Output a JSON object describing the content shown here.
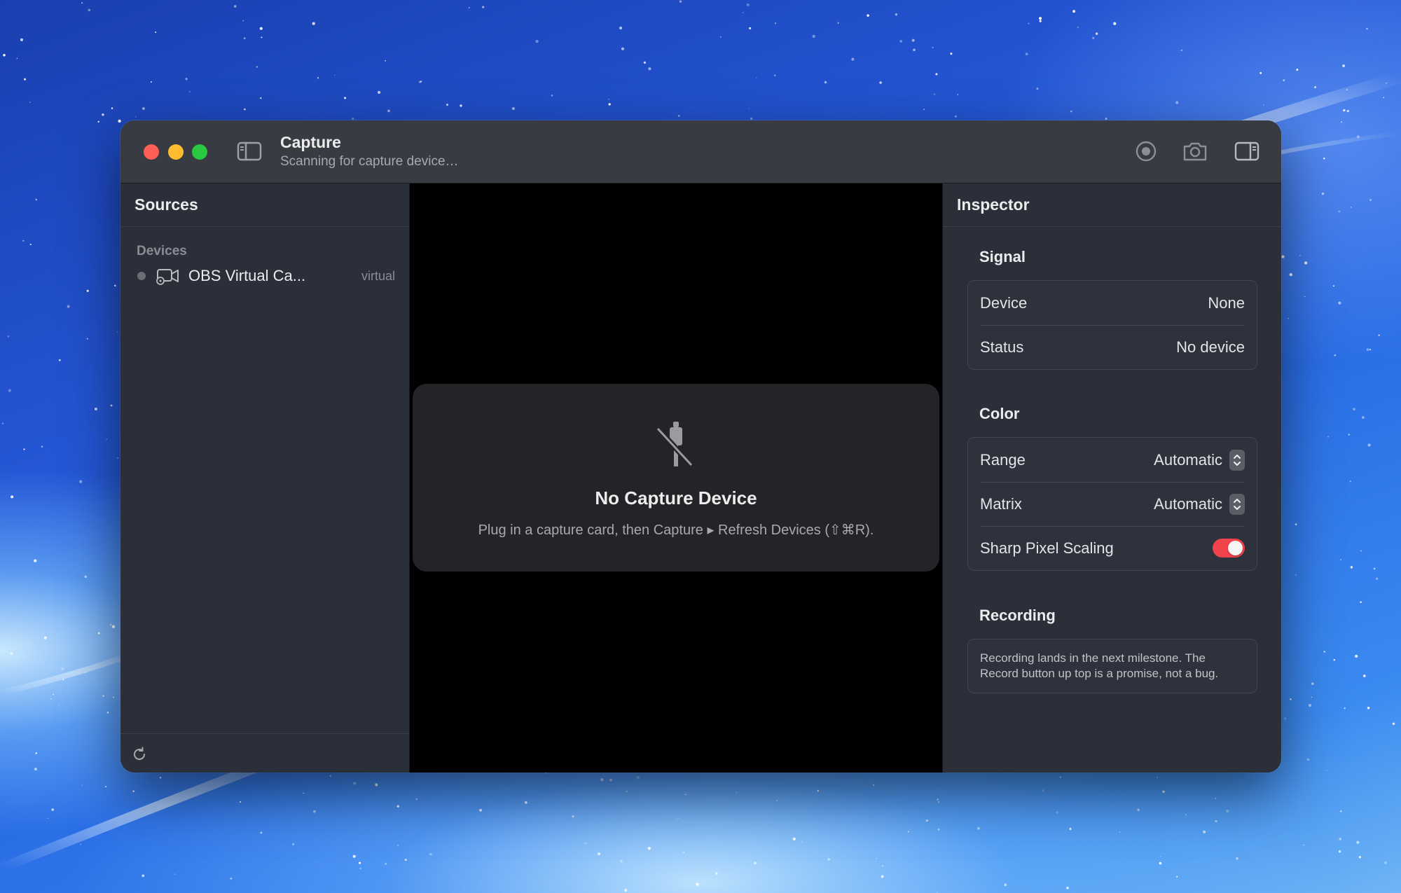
{
  "window": {
    "title": "Capture",
    "subtitle": "Scanning for capture device…"
  },
  "toolbar": {
    "sidebar_toggle_icon": "sidebar-left-icon",
    "record_icon": "record-icon",
    "snapshot_icon": "camera-icon",
    "inspector_toggle_icon": "sidebar-right-icon"
  },
  "sidebar": {
    "header": "Sources",
    "section_label": "Devices",
    "devices": [
      {
        "name": "OBS Virtual Ca...",
        "tag": "virtual",
        "icon": "video-camera-icon"
      }
    ],
    "footer_icon": "refresh-icon"
  },
  "preview": {
    "empty_title": "No Capture Device",
    "empty_hint": "Plug in a capture card, then Capture ▸ Refresh Devices (⇧⌘R).",
    "empty_icon": "cable-disconnected-icon"
  },
  "inspector": {
    "header": "Inspector",
    "signal": {
      "title": "Signal",
      "device_label": "Device",
      "device_value": "None",
      "status_label": "Status",
      "status_value": "No device"
    },
    "color": {
      "title": "Color",
      "range_label": "Range",
      "range_value": "Automatic",
      "matrix_label": "Matrix",
      "matrix_value": "Automatic",
      "sharp_label": "Sharp Pixel Scaling",
      "sharp_on": true
    },
    "recording": {
      "title": "Recording",
      "note": "Recording lands in the next milestone. The Record button up top is a promise, not a bug."
    }
  },
  "colors": {
    "accent_toggle": "#f0434b",
    "close": "#fe5f57",
    "minimize": "#febc2e",
    "zoom": "#28c840"
  }
}
